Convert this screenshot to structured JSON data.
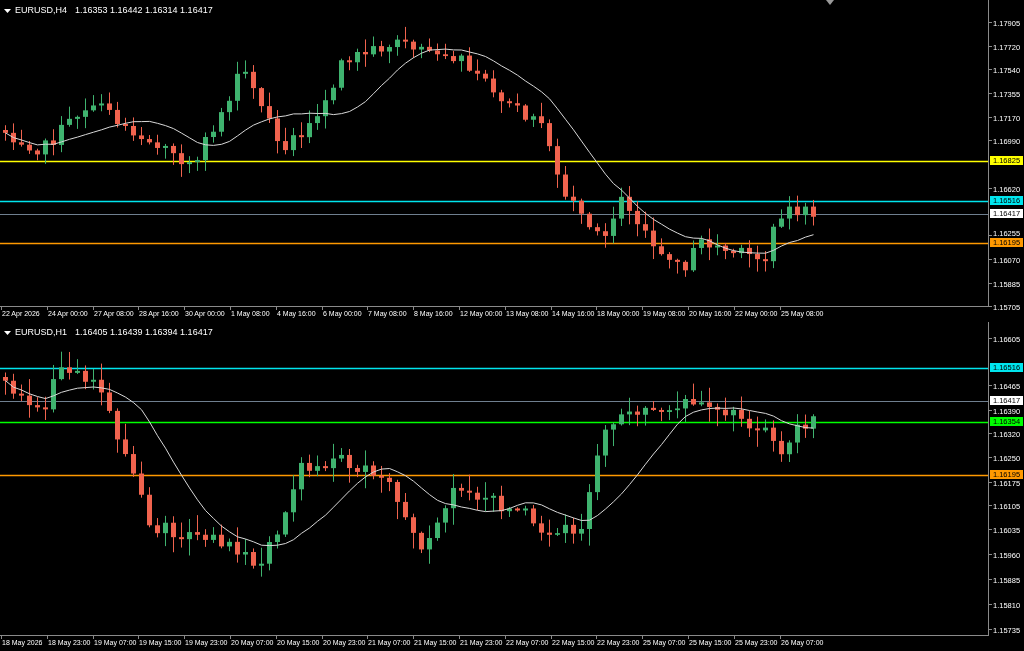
{
  "panes": [
    {
      "header": {
        "symbol": "EURUSD,H4",
        "ohlc": "1.16353 1.16442 1.16314 1.16417"
      },
      "price_ticks": [
        "1.17905",
        "1.17720",
        "1.17540",
        "1.17355",
        "1.17170",
        "1.16990",
        "1.16620",
        "1.16255",
        "1.16070",
        "1.15885",
        "1.15705"
      ],
      "levels": [
        {
          "kind": "level",
          "price": "1.16825",
          "color": "#ffff00"
        },
        {
          "kind": "level",
          "price": "1.16516",
          "color": "#00e5ee"
        },
        {
          "kind": "bid",
          "price": "1.16417",
          "color": "#ffffff"
        },
        {
          "kind": "level",
          "price": "1.16195",
          "color": "#ff9900"
        }
      ],
      "time_labels": [
        "22 Apr 2026",
        "24 Apr 00:00",
        "27 Apr 08:00",
        "28 Apr 16:00",
        "30 Apr 00:00",
        "1 May 08:00",
        "4 May 16:00",
        "6 May 00:00",
        "7 May 08:00",
        "8 May 16:00",
        "12 May 00:00",
        "13 May 08:00",
        "14 May 16:00",
        "18 May 00:00",
        "19 May 08:00",
        "20 May 16:00",
        "22 May 00:00",
        "25 May 08:00"
      ]
    },
    {
      "header": {
        "symbol": "EURUSD,H1",
        "ohlc": "1.16405 1.16439 1.16394 1.16417"
      },
      "price_ticks": [
        "1.16605",
        "1.16465",
        "1.16390",
        "1.16320",
        "1.16250",
        "1.16175",
        "1.16105",
        "1.16035",
        "1.15960",
        "1.15885",
        "1.15810",
        "1.15735"
      ],
      "levels": [
        {
          "kind": "level",
          "price": "1.16516",
          "color": "#00e5ee"
        },
        {
          "kind": "bid",
          "price": "1.16417",
          "color": "#ffffff"
        },
        {
          "kind": "level",
          "price": "1.16354",
          "color": "#00ff00"
        },
        {
          "kind": "level",
          "price": "1.16195",
          "color": "#ff9900"
        }
      ],
      "time_labels": [
        "18 May 2026",
        "18 May 23:00",
        "19 May 07:00",
        "19 May 15:00",
        "19 May 23:00",
        "20 May 07:00",
        "20 May 15:00",
        "20 May 23:00",
        "21 May 07:00",
        "21 May 15:00",
        "21 May 23:00",
        "22 May 07:00",
        "22 May 15:00",
        "22 May 23:00",
        "25 May 07:00",
        "25 May 15:00",
        "25 May 23:00",
        "26 May 07:00"
      ]
    }
  ]
}
